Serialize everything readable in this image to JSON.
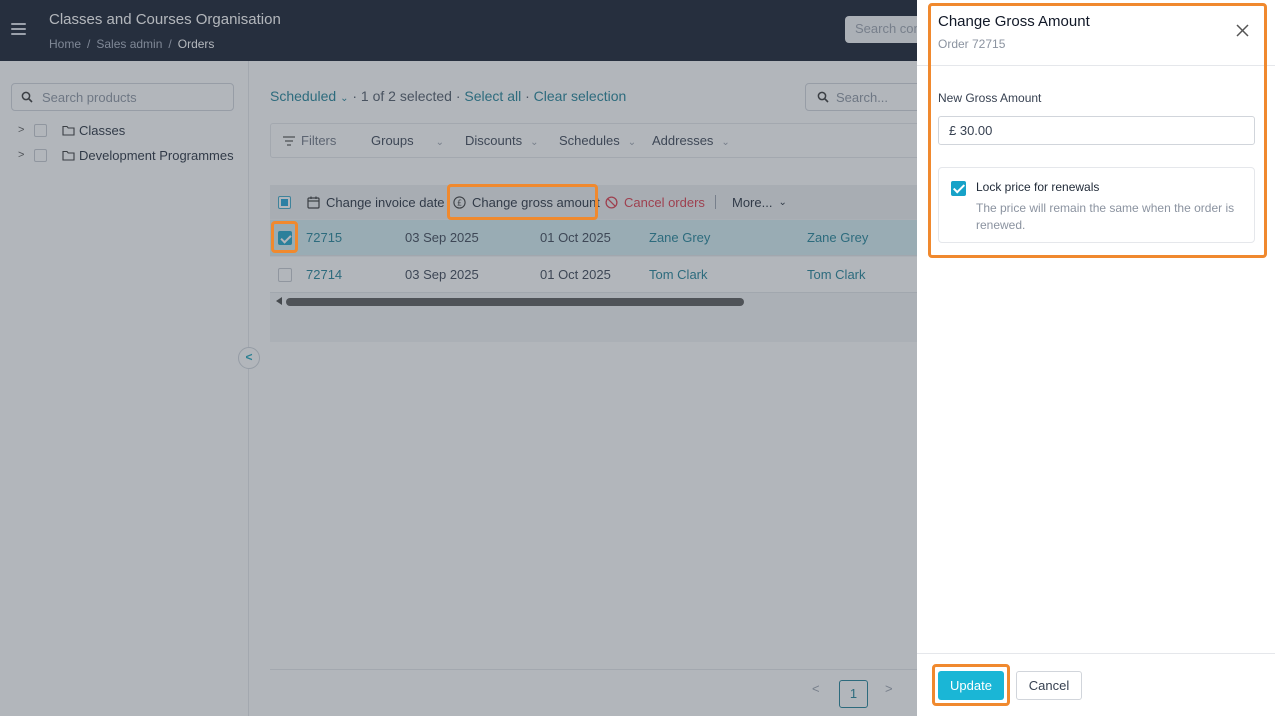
{
  "header": {
    "app_title": "Classes and Courses Organisation",
    "breadcrumb": [
      "Home",
      "Sales admin",
      "Orders"
    ],
    "search_placeholder": "Search con"
  },
  "sidebar": {
    "search_placeholder": "Search products",
    "tree": [
      {
        "label": "Classes"
      },
      {
        "label": "Development Programmes"
      }
    ],
    "collapse_glyph": "<"
  },
  "main": {
    "status_filter": "Scheduled",
    "selection_text": "· 1 of 2 selected ·",
    "select_all": "Select all",
    "clear_selection": "Clear selection",
    "search_placeholder": "Search...",
    "filters": [
      "Filters",
      "Groups",
      "Discounts",
      "Schedules",
      "Addresses"
    ],
    "bulk_actions": {
      "change_invoice_date": "Change invoice date",
      "change_gross_amount": "Change gross amount",
      "cancel_orders": "Cancel orders",
      "more": "More..."
    },
    "rows": [
      {
        "id": "72715",
        "date1": "03 Sep 2025",
        "date2": "01 Oct 2025",
        "name1": "Zane Grey",
        "name2": "Zane Grey",
        "selected": true
      },
      {
        "id": "72714",
        "date1": "03 Sep 2025",
        "date2": "01 Oct 2025",
        "name1": "Tom Clark",
        "name2": "Tom Clark",
        "selected": false
      }
    ],
    "pagination": {
      "prev": "<",
      "page": "1",
      "next": ">"
    }
  },
  "panel": {
    "title": "Change Gross Amount",
    "subtitle": "Order 72715",
    "field_label": "New Gross Amount",
    "amount_value": "£ 30.00",
    "lock_title": "Lock price for renewals",
    "lock_desc": "The price will remain the same when the order is renewed.",
    "lock_checked": true,
    "update_label": "Update",
    "cancel_label": "Cancel"
  },
  "colors": {
    "accent": "#1ab6d6",
    "link": "#1a7f95",
    "highlight": "#f0892e",
    "danger": "#dc3545",
    "topbar": "#0f1729"
  }
}
